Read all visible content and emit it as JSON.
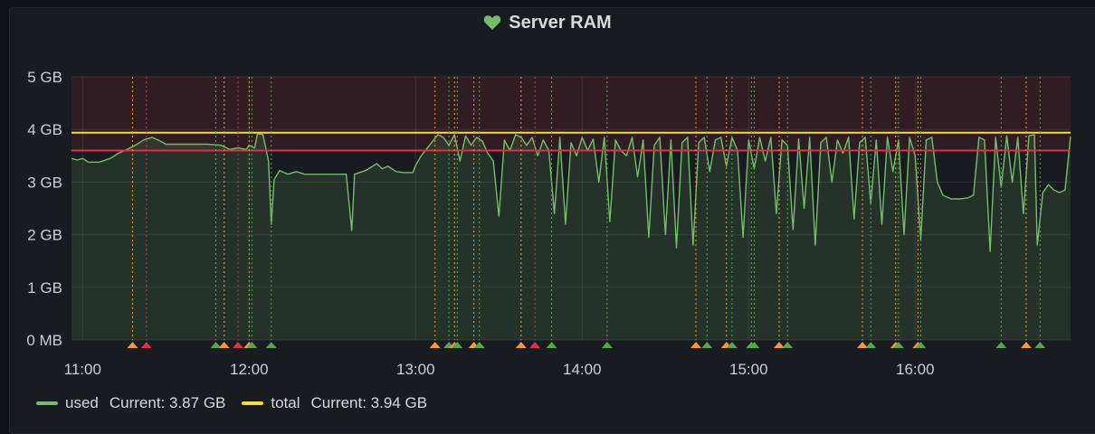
{
  "panel": {
    "title": "Server RAM",
    "status_icon": "heart-icon",
    "status_color": "#73bf69"
  },
  "legend": [
    {
      "name": "used",
      "value_text": "Current: 3.87 GB",
      "color": "#73bf69"
    },
    {
      "name": "total",
      "value_text": "Current: 3.94 GB",
      "color": "#fade2a"
    }
  ],
  "chart_data": {
    "type": "area",
    "x_range": [
      "10:56",
      "16:56"
    ],
    "ylim": [
      0,
      5
    ],
    "y_unit": "GB",
    "x_ticks": [
      "11:00",
      "12:00",
      "13:00",
      "14:00",
      "15:00",
      "16:00"
    ],
    "y_ticks": [
      "0 MB",
      "1 GB",
      "2 GB",
      "3 GB",
      "4 GB",
      "5 GB"
    ],
    "threshold": {
      "value": 3.6,
      "color": "#e02f44"
    },
    "alert_zone": {
      "from": 3.6,
      "to": 5
    },
    "series": [
      {
        "name": "used",
        "color": "#73bf69",
        "points": [
          [
            "10:56",
            3.45
          ],
          [
            "10:58",
            3.42
          ],
          [
            "11:00",
            3.45
          ],
          [
            "11:02",
            3.38
          ],
          [
            "11:06",
            3.38
          ],
          [
            "11:10",
            3.45
          ],
          [
            "11:13",
            3.55
          ],
          [
            "11:16",
            3.62
          ],
          [
            "11:19",
            3.7
          ],
          [
            "11:22",
            3.8
          ],
          [
            "11:25",
            3.85
          ],
          [
            "11:28",
            3.78
          ],
          [
            "11:30",
            3.72
          ],
          [
            "11:35",
            3.72
          ],
          [
            "11:40",
            3.72
          ],
          [
            "11:45",
            3.72
          ],
          [
            "11:50",
            3.7
          ],
          [
            "11:53",
            3.62
          ],
          [
            "11:56",
            3.65
          ],
          [
            "11:59",
            3.62
          ],
          [
            "12:00",
            3.7
          ],
          [
            "12:02",
            3.65
          ],
          [
            "12:03",
            3.92
          ],
          [
            "12:05",
            3.9
          ],
          [
            "12:07",
            3.4
          ],
          [
            "12:08",
            2.2
          ],
          [
            "12:09",
            3.05
          ],
          [
            "12:11",
            3.22
          ],
          [
            "12:14",
            3.15
          ],
          [
            "12:17",
            3.2
          ],
          [
            "12:20",
            3.15
          ],
          [
            "12:25",
            3.15
          ],
          [
            "12:30",
            3.15
          ],
          [
            "12:35",
            3.15
          ],
          [
            "12:37",
            2.08
          ],
          [
            "12:38",
            3.15
          ],
          [
            "12:42",
            3.22
          ],
          [
            "12:46",
            3.35
          ],
          [
            "12:48",
            3.25
          ],
          [
            "12:50",
            3.3
          ],
          [
            "12:53",
            3.2
          ],
          [
            "12:56",
            3.18
          ],
          [
            "12:59",
            3.18
          ],
          [
            "13:00",
            3.32
          ],
          [
            "13:02",
            3.5
          ],
          [
            "13:05",
            3.7
          ],
          [
            "13:08",
            3.9
          ],
          [
            "13:10",
            3.85
          ],
          [
            "13:12",
            3.7
          ],
          [
            "13:14",
            3.9
          ],
          [
            "13:16",
            3.4
          ],
          [
            "13:18",
            3.88
          ],
          [
            "13:20",
            3.7
          ],
          [
            "13:22",
            3.85
          ],
          [
            "13:24",
            3.78
          ],
          [
            "13:26",
            3.55
          ],
          [
            "13:28",
            3.4
          ],
          [
            "13:30",
            2.35
          ],
          [
            "13:32",
            3.8
          ],
          [
            "13:34",
            3.6
          ],
          [
            "13:36",
            3.9
          ],
          [
            "13:38",
            3.85
          ],
          [
            "13:40",
            3.7
          ],
          [
            "13:42",
            3.85
          ],
          [
            "13:44",
            3.5
          ],
          [
            "13:46",
            3.8
          ],
          [
            "13:48",
            3.6
          ],
          [
            "13:50",
            2.4
          ],
          [
            "13:52",
            3.85
          ],
          [
            "13:54",
            2.2
          ],
          [
            "13:56",
            3.75
          ],
          [
            "13:58",
            3.5
          ],
          [
            "14:00",
            3.85
          ],
          [
            "14:02",
            3.6
          ],
          [
            "14:04",
            3.82
          ],
          [
            "14:06",
            3.0
          ],
          [
            "14:08",
            3.85
          ],
          [
            "14:10",
            2.25
          ],
          [
            "14:12",
            3.8
          ],
          [
            "14:14",
            3.6
          ],
          [
            "14:16",
            3.5
          ],
          [
            "14:18",
            3.85
          ],
          [
            "14:20",
            3.1
          ],
          [
            "14:22",
            3.8
          ],
          [
            "14:24",
            1.95
          ],
          [
            "14:26",
            3.7
          ],
          [
            "14:28",
            3.85
          ],
          [
            "14:30",
            2.0
          ],
          [
            "14:32",
            3.8
          ],
          [
            "14:34",
            1.75
          ],
          [
            "14:36",
            3.75
          ],
          [
            "14:38",
            3.85
          ],
          [
            "14:40",
            1.8
          ],
          [
            "14:42",
            3.75
          ],
          [
            "14:44",
            3.85
          ],
          [
            "14:46",
            3.2
          ],
          [
            "14:48",
            3.8
          ],
          [
            "14:50",
            3.85
          ],
          [
            "14:52",
            3.3
          ],
          [
            "14:54",
            3.85
          ],
          [
            "14:56",
            3.6
          ],
          [
            "14:58",
            1.95
          ],
          [
            "15:00",
            3.8
          ],
          [
            "15:02",
            3.25
          ],
          [
            "15:04",
            3.85
          ],
          [
            "15:06",
            3.4
          ],
          [
            "15:08",
            3.85
          ],
          [
            "15:10",
            2.4
          ],
          [
            "15:12",
            3.8
          ],
          [
            "15:14",
            3.7
          ],
          [
            "15:16",
            2.1
          ],
          [
            "15:18",
            3.82
          ],
          [
            "15:20",
            2.5
          ],
          [
            "15:22",
            3.85
          ],
          [
            "15:24",
            1.8
          ],
          [
            "15:26",
            3.75
          ],
          [
            "15:28",
            3.85
          ],
          [
            "15:30",
            3.0
          ],
          [
            "15:32",
            3.8
          ],
          [
            "15:34",
            3.55
          ],
          [
            "15:36",
            3.85
          ],
          [
            "15:38",
            2.3
          ],
          [
            "15:40",
            3.75
          ],
          [
            "15:42",
            3.85
          ],
          [
            "15:44",
            2.6
          ],
          [
            "15:46",
            3.8
          ],
          [
            "15:48",
            2.2
          ],
          [
            "15:50",
            3.85
          ],
          [
            "15:52",
            3.2
          ],
          [
            "15:54",
            3.8
          ],
          [
            "15:56",
            2.0
          ],
          [
            "15:58",
            3.85
          ],
          [
            "16:00",
            3.5
          ],
          [
            "16:02",
            1.9
          ],
          [
            "16:04",
            3.8
          ],
          [
            "16:06",
            3.85
          ],
          [
            "16:08",
            3.0
          ],
          [
            "16:10",
            2.75
          ],
          [
            "16:13",
            2.68
          ],
          [
            "16:16",
            2.68
          ],
          [
            "16:19",
            2.7
          ],
          [
            "16:21",
            2.75
          ],
          [
            "16:23",
            3.85
          ],
          [
            "16:25",
            3.8
          ],
          [
            "16:27",
            1.68
          ],
          [
            "16:29",
            3.85
          ],
          [
            "16:31",
            2.9
          ],
          [
            "16:33",
            3.88
          ],
          [
            "16:35",
            3.0
          ],
          [
            "16:37",
            3.85
          ],
          [
            "16:39",
            2.4
          ],
          [
            "16:41",
            3.88
          ],
          [
            "16:43",
            3.9
          ],
          [
            "16:44",
            1.8
          ],
          [
            "16:46",
            2.8
          ],
          [
            "16:48",
            2.95
          ],
          [
            "16:50",
            2.85
          ],
          [
            "16:52",
            2.8
          ],
          [
            "16:54",
            2.85
          ],
          [
            "16:56",
            3.87
          ]
        ]
      },
      {
        "name": "total",
        "color": "#fade2a",
        "points": [
          [
            "10:56",
            3.94
          ],
          [
            "16:56",
            3.94
          ]
        ]
      }
    ],
    "annotations": [
      {
        "time": "11:18",
        "state": "pending",
        "color": "#ff9830"
      },
      {
        "time": "11:23",
        "state": "alerting",
        "color": "#e02f44"
      },
      {
        "time": "11:48",
        "state": "ok",
        "color": "#56a64b"
      },
      {
        "time": "11:51",
        "state": "pending",
        "color": "#ff9830"
      },
      {
        "time": "11:56",
        "state": "alerting",
        "color": "#e02f44"
      },
      {
        "time": "12:00",
        "state": "pending",
        "color": "#ff9830"
      },
      {
        "time": "12:01",
        "state": "ok",
        "color": "#56a64b"
      },
      {
        "time": "12:08",
        "state": "ok",
        "color": "#56a64b"
      },
      {
        "time": "13:07",
        "state": "pending",
        "color": "#ff9830"
      },
      {
        "time": "13:12",
        "state": "ok",
        "color": "#56a64b"
      },
      {
        "time": "13:14",
        "state": "pending",
        "color": "#ff9830"
      },
      {
        "time": "13:15",
        "state": "ok",
        "color": "#56a64b"
      },
      {
        "time": "13:21",
        "state": "pending",
        "color": "#ff9830"
      },
      {
        "time": "13:23",
        "state": "ok",
        "color": "#56a64b"
      },
      {
        "time": "13:38",
        "state": "pending",
        "color": "#ff9830"
      },
      {
        "time": "13:43",
        "state": "alerting",
        "color": "#e02f44"
      },
      {
        "time": "13:49",
        "state": "ok",
        "color": "#56a64b"
      },
      {
        "time": "14:09",
        "state": "ok",
        "color": "#56a64b"
      },
      {
        "time": "14:41",
        "state": "pending",
        "color": "#ff9830"
      },
      {
        "time": "14:45",
        "state": "ok",
        "color": "#56a64b"
      },
      {
        "time": "14:52",
        "state": "pending",
        "color": "#ff9830"
      },
      {
        "time": "14:54",
        "state": "ok",
        "color": "#56a64b"
      },
      {
        "time": "15:01",
        "state": "ok",
        "color": "#56a64b"
      },
      {
        "time": "15:02",
        "state": "ok",
        "color": "#56a64b"
      },
      {
        "time": "15:11",
        "state": "pending",
        "color": "#ff9830"
      },
      {
        "time": "15:14",
        "state": "ok",
        "color": "#56a64b"
      },
      {
        "time": "15:41",
        "state": "pending",
        "color": "#ff9830"
      },
      {
        "time": "15:44",
        "state": "ok",
        "color": "#56a64b"
      },
      {
        "time": "15:53",
        "state": "pending",
        "color": "#ff9830"
      },
      {
        "time": "15:54",
        "state": "ok",
        "color": "#56a64b"
      },
      {
        "time": "16:01",
        "state": "pending",
        "color": "#ff9830"
      },
      {
        "time": "16:02",
        "state": "ok",
        "color": "#56a64b"
      },
      {
        "time": "16:31",
        "state": "ok",
        "color": "#56a64b"
      },
      {
        "time": "16:40",
        "state": "pending",
        "color": "#ff9830"
      },
      {
        "time": "16:45",
        "state": "ok",
        "color": "#56a64b"
      }
    ]
  }
}
